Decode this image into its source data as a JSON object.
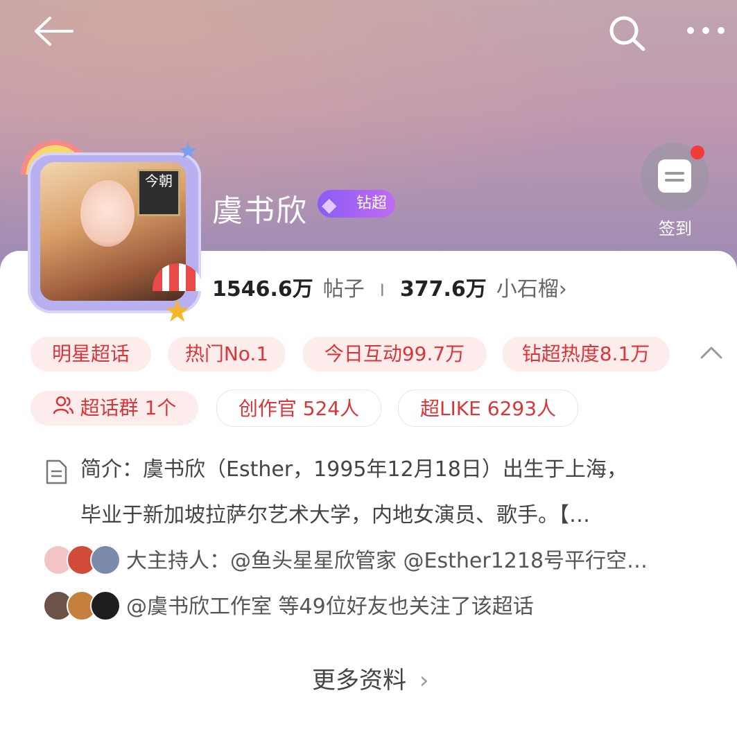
{
  "topbar": {
    "back_icon": "arrow-left-icon",
    "search_icon": "search-icon",
    "more_icon": "more-horizontal-icon"
  },
  "profile": {
    "name": "虞书欣",
    "badge_label": "钻超",
    "avatar_sign": "今朝",
    "checkin_label": "签到"
  },
  "stats": {
    "posts_count": "1546.6万",
    "posts_label": "帖子",
    "separator": "I",
    "pomegranate_count": "377.6万",
    "pomegranate_label": "小石榴",
    "pomegranate_arrow": "›"
  },
  "tags_row1": [
    "明星超话",
    "热门No.1",
    "今日互动99.7万",
    "钻超热度8.1万"
  ],
  "tags_row2": [
    "超话群 1个",
    "创作官 524人",
    "超LIKE 6293人"
  ],
  "intro": {
    "line1": "简介：虞书欣（Esther，1995年12月18日）出生于上海，",
    "line2": "毕业于新加坡拉萨尔艺术大学，内地女演员、歌手。【…"
  },
  "hosts": {
    "text": "大主持人：@鱼头星星欣管家 @Esther1218号平行空…"
  },
  "friends": {
    "text": "@虞书欣工作室 等49位好友也关注了该超话"
  },
  "more_info": {
    "label": "更多资料",
    "arrow": "›"
  },
  "colors": {
    "accent": "#d9363a",
    "chip_bg": "#fdecec",
    "badge_start": "#8a5cf5",
    "badge_end": "#c06cf2"
  }
}
